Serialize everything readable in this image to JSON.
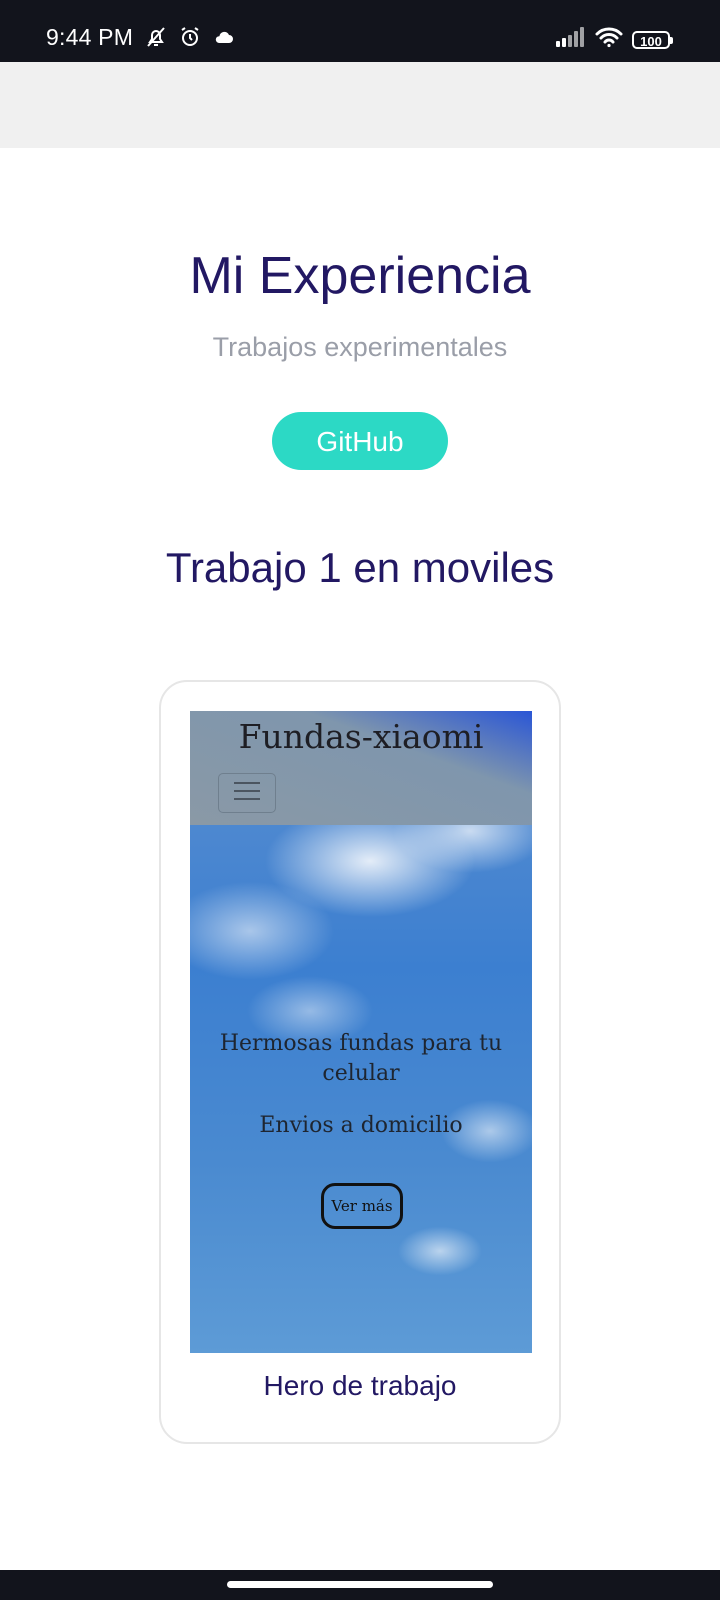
{
  "status_bar": {
    "time": "9:44 PM",
    "icons_left": [
      "bell-off-icon",
      "alarm-icon",
      "cloud-icon"
    ],
    "icons_right": [
      "signal-icon",
      "wifi-icon",
      "battery-icon"
    ],
    "battery_level": "100"
  },
  "header": {
    "title": "Mi Experiencia",
    "subtitle": "Trabajos experimentales",
    "github_label": "GitHub",
    "github_color": "#2cd9c5",
    "title_color": "#221863"
  },
  "section": {
    "title": "Trabajo 1 en moviles"
  },
  "project_card": {
    "preview": {
      "brand": "Fundas-xiaomi",
      "headline": "Hermosas fundas para tu celular",
      "subheadline": "Envios a domicilio",
      "cta_label": "Ver más",
      "menu_icon": "hamburger-icon"
    },
    "caption": "Hero de trabajo"
  }
}
